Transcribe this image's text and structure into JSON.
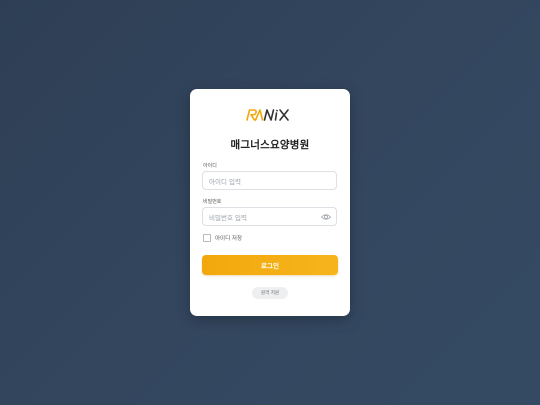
{
  "brand": {
    "logo_text": "RANIX",
    "accent_color": "#f2a80c",
    "dark_color": "#333333"
  },
  "login": {
    "title": "매그너스요양병원",
    "id_label": "아이디",
    "id_placeholder": "아이디 입력",
    "password_label": "비밀번호",
    "password_placeholder": "비밀번호 입력",
    "password_toggle_icon": "eye-icon",
    "remember_label": "아이디 저장",
    "remember_checked": false,
    "submit_label": "로그인",
    "help_label": "원격 지원"
  },
  "colors": {
    "background": "#33465e",
    "card": "#ffffff",
    "button": "#f2a80c"
  }
}
